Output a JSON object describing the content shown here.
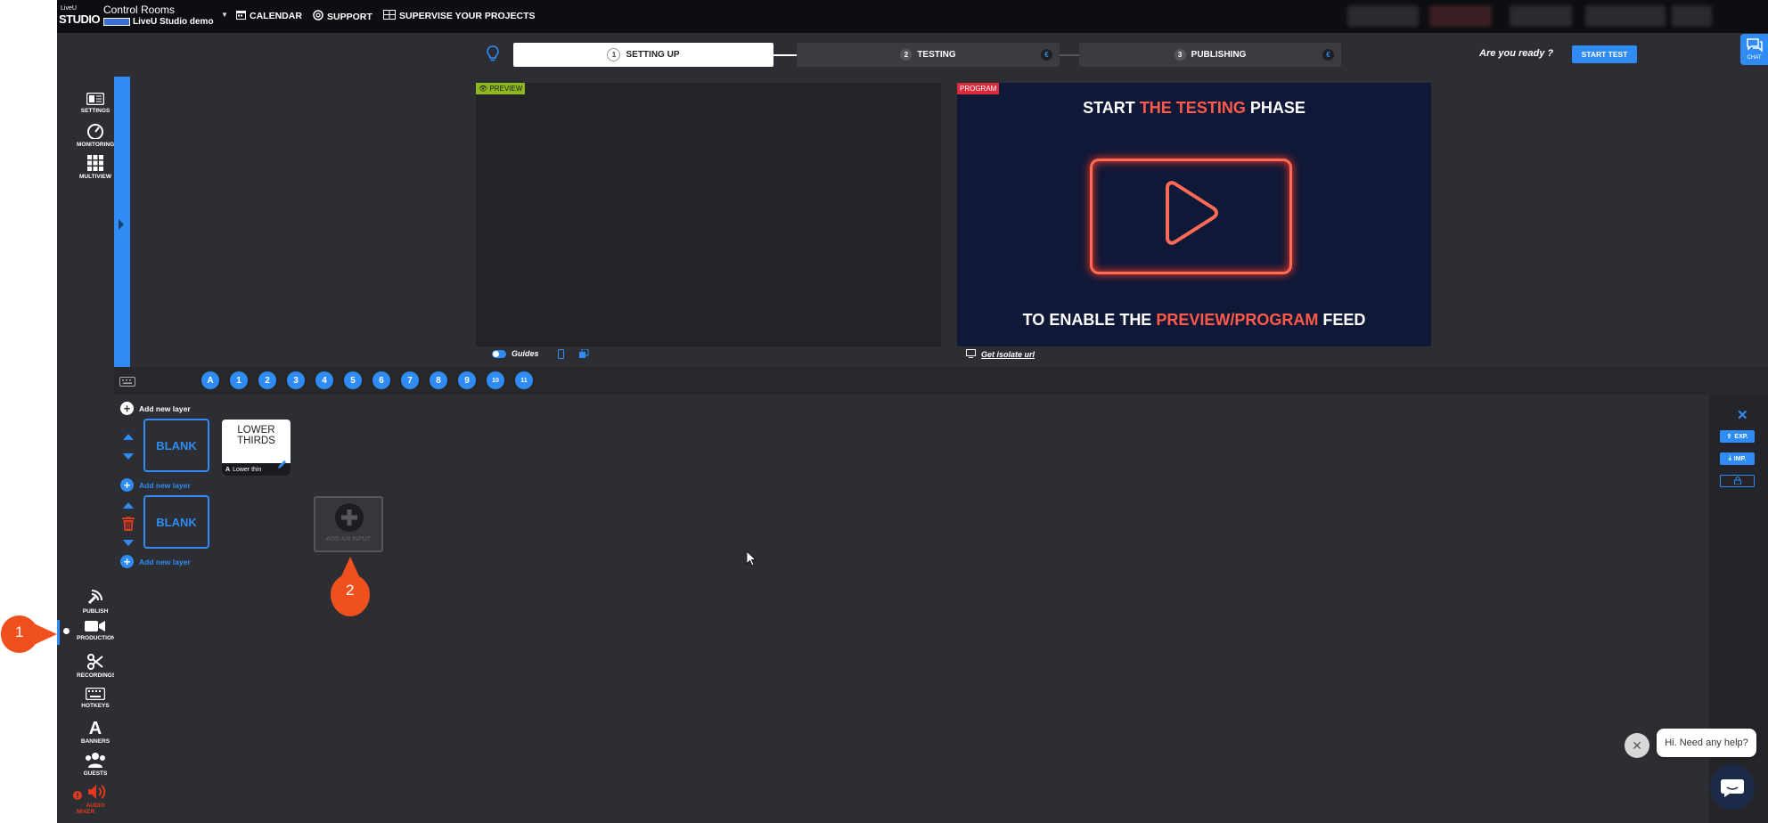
{
  "header": {
    "logo_top": "LiveU",
    "logo_bottom": "STUDIO",
    "control_rooms": "Control Rooms",
    "studio_name": "LiveU Studio demo",
    "nav": [
      "CALENDAR",
      "SUPPORT",
      "SUPERVISE YOUR PROJECTS"
    ]
  },
  "steps": {
    "items": [
      {
        "num": "1",
        "label": "SETTING UP"
      },
      {
        "num": "2",
        "label": "TESTING"
      },
      {
        "num": "3",
        "label": "PUBLISHING"
      }
    ],
    "ready_label": "Are you ready ?",
    "start_test": "START TEST",
    "euro_symbol": "€"
  },
  "chat_label": "CHAT",
  "sidebar": {
    "top": [
      "SETTINGS",
      "MONITORING",
      "MULTIVIEW"
    ],
    "bottom": [
      "PUBLISH",
      "PRODUCTION",
      "RECORDINGS",
      "HOTKEYS",
      "BANNERS",
      "GUESTS",
      "AUDIO MIXER"
    ],
    "active": "PRODUCTION"
  },
  "preview": {
    "tag": "PREVIEW",
    "guides": "Guides"
  },
  "program": {
    "tag": "PROGRAM",
    "line1_a": "START ",
    "line1_b": "THE TESTING",
    "line1_c": " PHASE",
    "line2_a": "TO ENABLE THE ",
    "line2_b": "PREVIEW/PROGRAM",
    "line2_c": " FEED",
    "get_isolate": "Get isolate url"
  },
  "scenes": [
    "A",
    "1",
    "2",
    "3",
    "4",
    "5",
    "6",
    "7",
    "8",
    "9",
    "10",
    "11"
  ],
  "layers": {
    "add_new_layer": "Add new layer",
    "blank": "BLANK",
    "lower_thirds": "LOWER THIRDS",
    "lower_thin": "Lower thin",
    "add_input": "ADD AN INPUT"
  },
  "right_panel": {
    "exp": "EXP.",
    "imp": "IMP."
  },
  "markers": {
    "m1": "1",
    "m2": "2"
  },
  "help": {
    "text": "Hi. Need any help?"
  },
  "colors": {
    "accent": "#2f8cf4",
    "preview_tag": "#8eb81f",
    "program_tag": "#d92b3a",
    "marker": "#f0501e"
  }
}
